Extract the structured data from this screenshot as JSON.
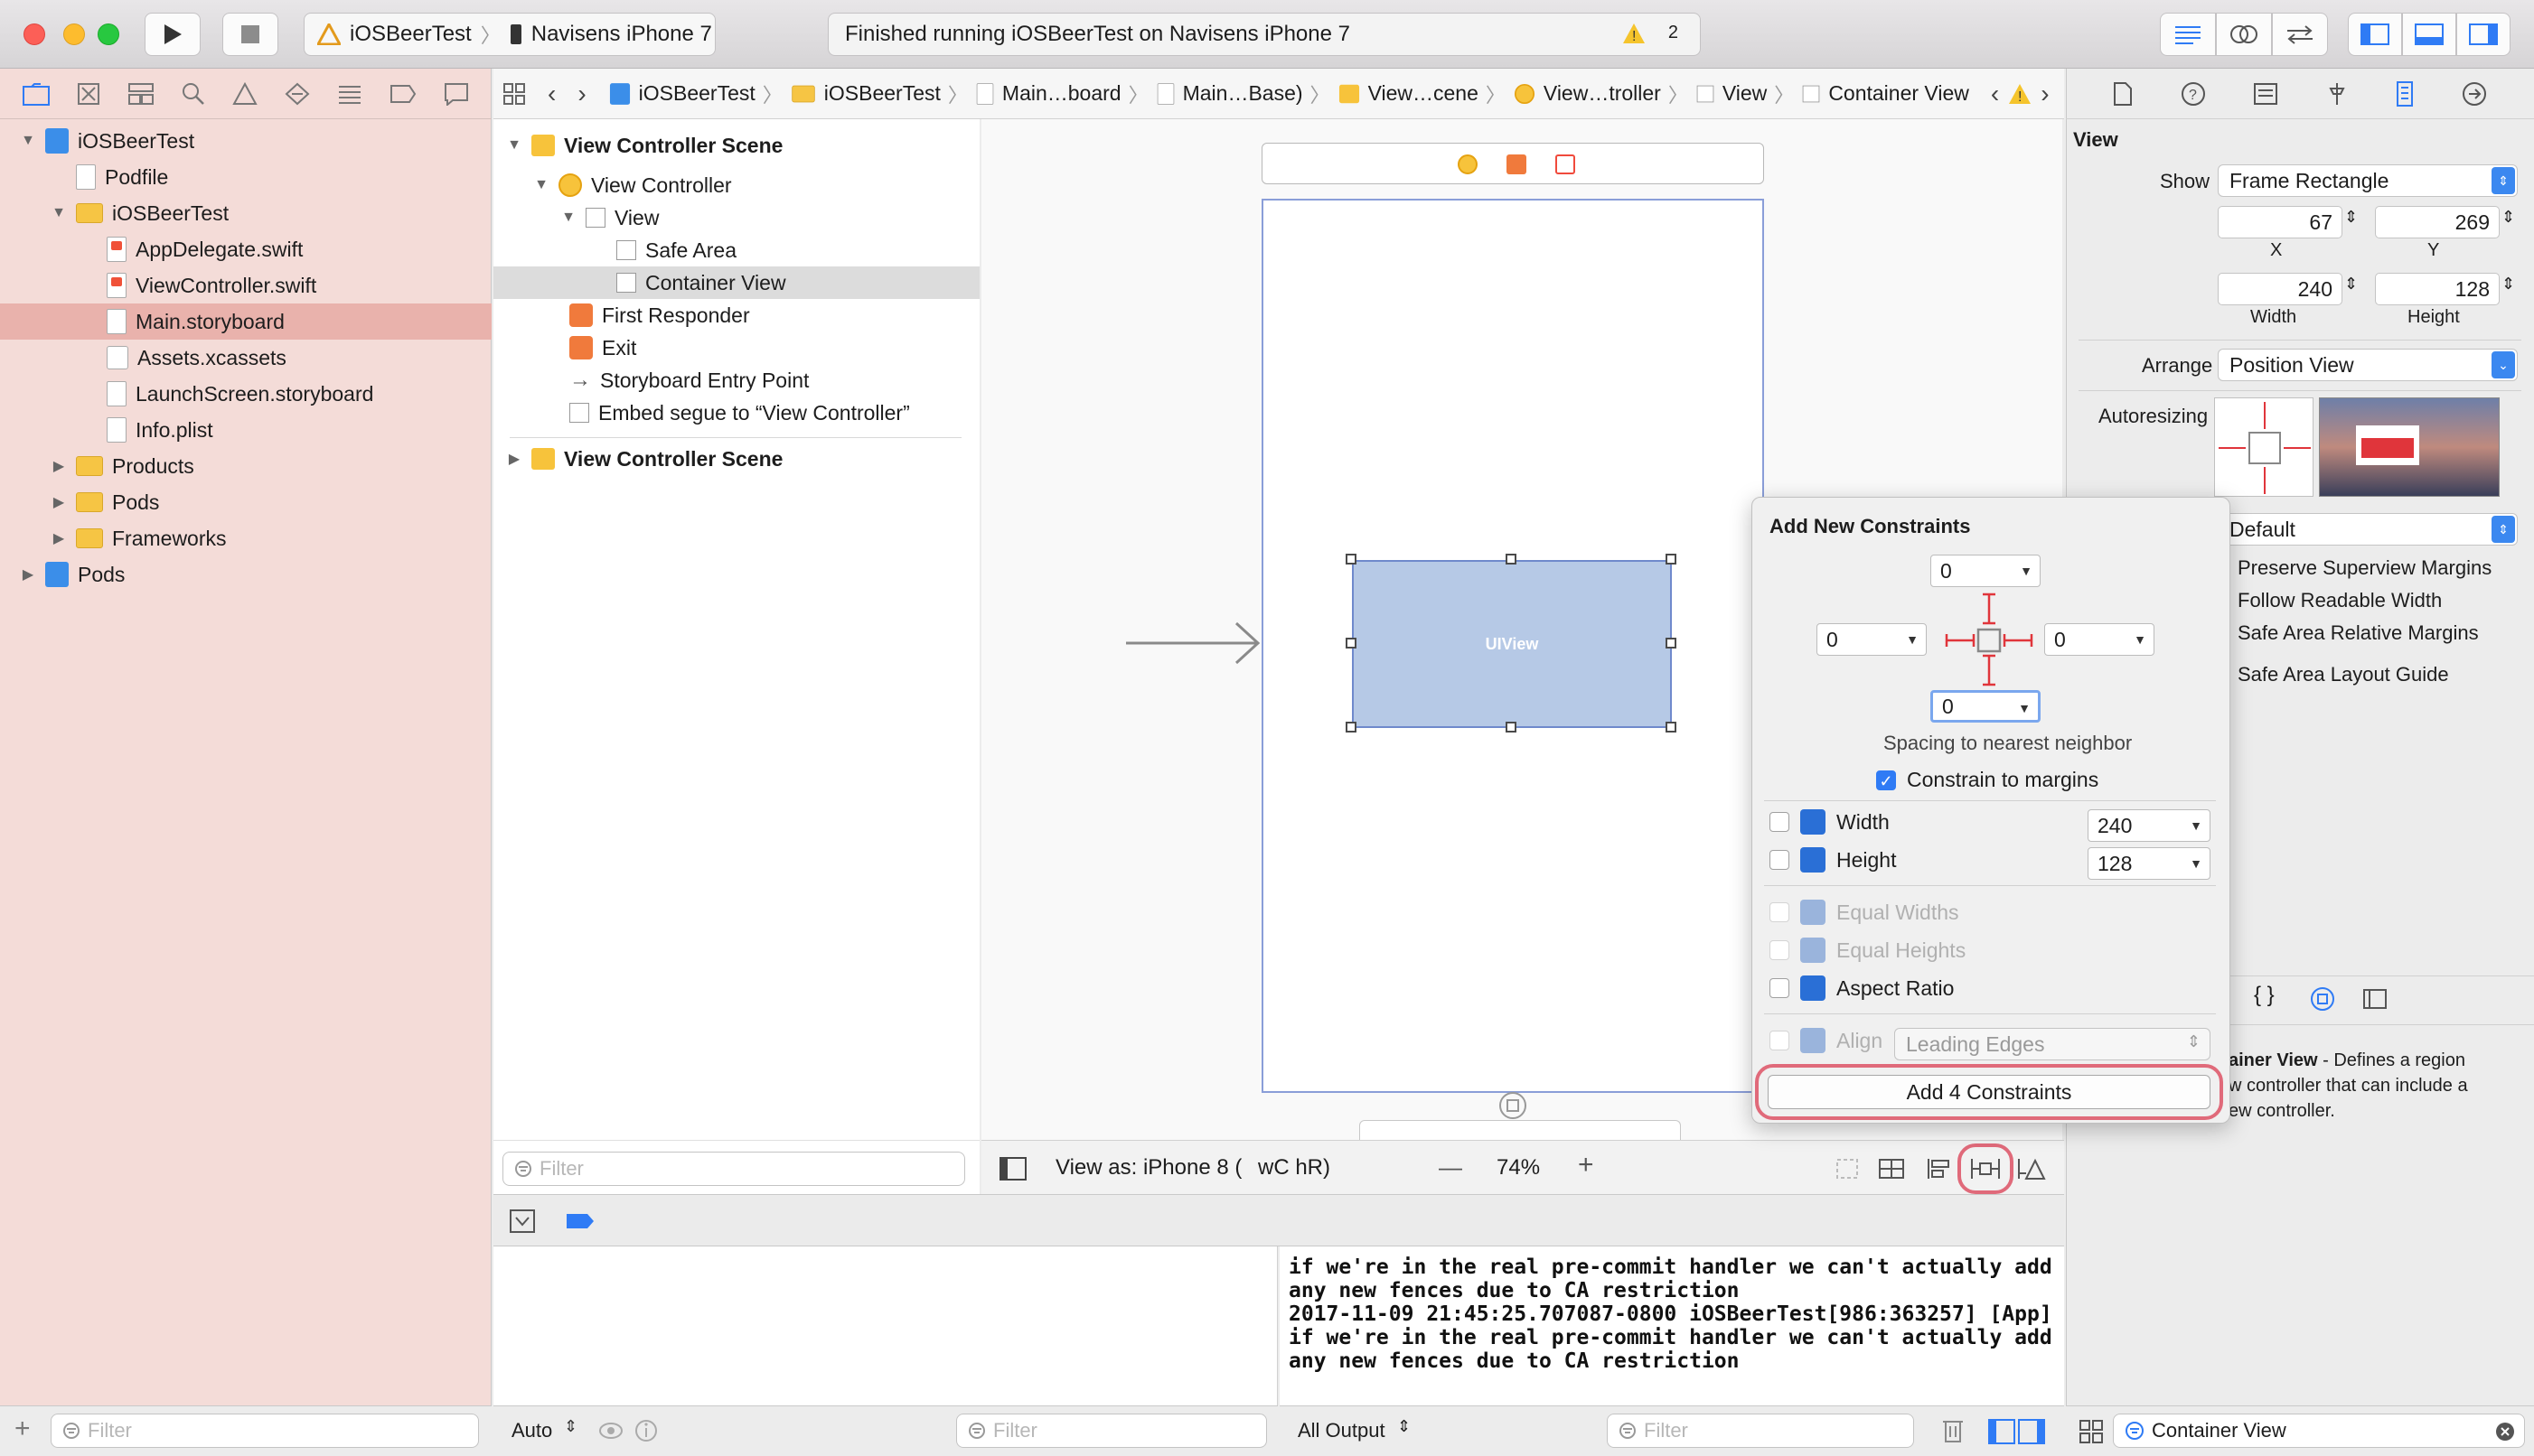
{
  "toolbar": {
    "scheme_app": "iOSBeerTest",
    "scheme_device": "Navisens iPhone 7",
    "status_text": "Finished running iOSBeerTest on Navisens iPhone 7",
    "warning_count": "2"
  },
  "navigator": {
    "items": [
      {
        "label": "iOSBeerTest",
        "level": 0,
        "kind": "project",
        "expanded": true
      },
      {
        "label": "Podfile",
        "level": 1,
        "kind": "file"
      },
      {
        "label": "iOSBeerTest",
        "level": 1,
        "kind": "folder",
        "expanded": true
      },
      {
        "label": "AppDelegate.swift",
        "level": 2,
        "kind": "swift"
      },
      {
        "label": "ViewController.swift",
        "level": 2,
        "kind": "swift"
      },
      {
        "label": "Main.storyboard",
        "level": 2,
        "kind": "file",
        "selected": true
      },
      {
        "label": "Assets.xcassets",
        "level": 2,
        "kind": "assets"
      },
      {
        "label": "LaunchScreen.storyboard",
        "level": 2,
        "kind": "file"
      },
      {
        "label": "Info.plist",
        "level": 2,
        "kind": "file"
      },
      {
        "label": "Products",
        "level": 1,
        "kind": "folder"
      },
      {
        "label": "Pods",
        "level": 1,
        "kind": "folder"
      },
      {
        "label": "Frameworks",
        "level": 1,
        "kind": "folder"
      },
      {
        "label": "Pods",
        "level": 0,
        "kind": "project"
      }
    ],
    "filter_placeholder": "Filter"
  },
  "jumpbar": {
    "crumbs": [
      "iOSBeerTest",
      "iOSBeerTest",
      "Main…board",
      "Main…Base)",
      "View…cene",
      "View…troller",
      "View",
      "Container View"
    ]
  },
  "outline": {
    "rows": [
      {
        "label": "View Controller Scene",
        "bold": true
      },
      {
        "label": "View Controller"
      },
      {
        "label": "View"
      },
      {
        "label": "Safe Area"
      },
      {
        "label": "Container View",
        "selected": true
      },
      {
        "label": "First Responder"
      },
      {
        "label": "Exit"
      },
      {
        "label": "Storyboard Entry Point"
      },
      {
        "label": "Embed segue to “View Controller”"
      },
      {
        "label": "View Controller Scene",
        "bold": true
      }
    ],
    "filter_placeholder": "Filter"
  },
  "canvas": {
    "uiview_label": "UIView",
    "view_as": "View as: iPhone 8 (",
    "view_as_size": "wC hR)",
    "zoom": "74%",
    "minus": "—",
    "plus": "+"
  },
  "console": {
    "lines": [
      "if we're in the real pre-commit handler we can't actually add",
      "any new fences due to CA restriction",
      "2017-11-09 21:45:25.707087-0800 iOSBeerTest[986:363257] [App]",
      "if we're in the real pre-commit handler we can't actually add",
      "any new fences due to CA restriction"
    ],
    "auto_label": "Auto",
    "all_output_label": "All Output",
    "filter_placeholder": "Filter"
  },
  "inspector": {
    "section_title": "View",
    "show_label": "Show",
    "show_value": "Frame Rectangle",
    "x": "67",
    "y": "269",
    "x_label": "X",
    "y_label": "Y",
    "width": "240",
    "height": "128",
    "width_label": "Width",
    "height_label": "Height",
    "arrange_label": "Arrange",
    "arrange_value": "Position View",
    "autoresizing_label": "Autoresizing",
    "layout_value": "Default",
    "options": [
      "Preserve Superview Margins",
      "Follow Readable Width",
      "Safe Area Relative Margins",
      "Safe Area Layout Guide"
    ],
    "library_name": "ainer View",
    "library_desc_1": " - Defines a region",
    "library_desc_2": "w controller that can include a",
    "library_desc_3": "ew controller.",
    "search_value": "Container View"
  },
  "popover": {
    "title": "Add New Constraints",
    "top": "0",
    "left": "0",
    "right": "0",
    "bottom": "0",
    "spacing_label": "Spacing to nearest neighbor",
    "constrain_margins_label": "Constrain to margins",
    "width_label": "Width",
    "width_value": "240",
    "height_label": "Height",
    "height_value": "128",
    "equal_widths_label": "Equal Widths",
    "equal_heights_label": "Equal Heights",
    "aspect_ratio_label": "Aspect Ratio",
    "align_label": "Align",
    "align_value": "Leading Edges",
    "add_button_label": "Add 4 Constraints"
  },
  "colors": {
    "navigator_bg": "#f4dcd8",
    "selection": "#e9b2ac",
    "accent": "#2f7bf5",
    "highlight": "#e06a7a"
  }
}
